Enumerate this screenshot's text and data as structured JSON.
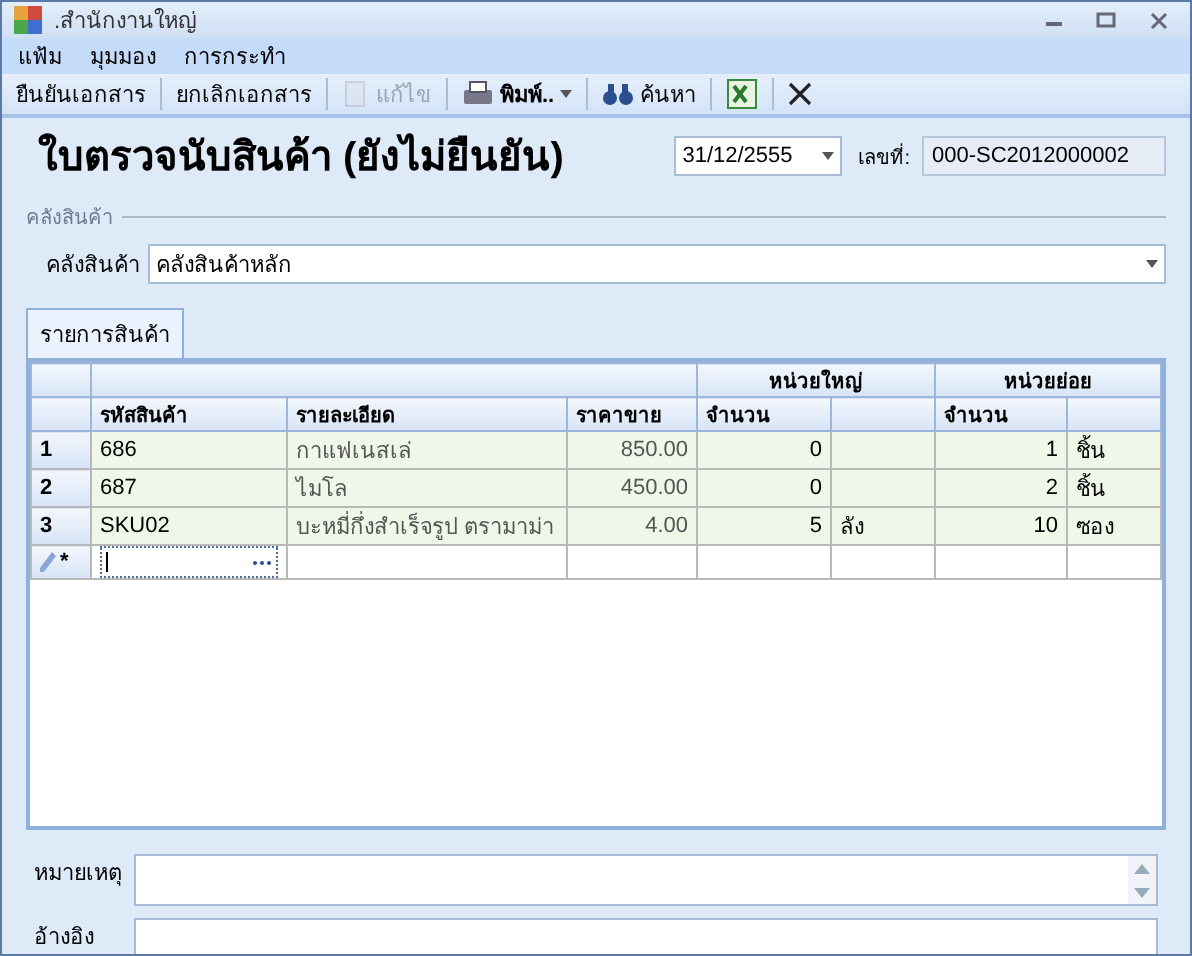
{
  "window": {
    "title": ".สำนักงานใหญ่"
  },
  "menu": [
    "แฟ้ม",
    "มุมมอง",
    "การกระทำ"
  ],
  "toolbar": [
    {
      "kind": "text",
      "label": "ยืนยันเอกสาร",
      "disabled": false
    },
    {
      "kind": "text",
      "label": "ยกเลิกเอกสาร",
      "disabled": false
    },
    {
      "kind": "edit",
      "label": "แก้ไข",
      "disabled": true
    },
    {
      "kind": "print",
      "label": "พิมพ์..",
      "disabled": false
    },
    {
      "kind": "find",
      "label": "ค้นหา",
      "disabled": false
    },
    {
      "kind": "excel",
      "disabled": false
    },
    {
      "kind": "close",
      "disabled": false
    }
  ],
  "heading": "ใบตรวจนับสินค้า (ยังไม่ยืนยัน)",
  "date": "31/12/2555",
  "doc_no": {
    "label": "เลขที่:",
    "value": "000-SC2012000002"
  },
  "group": {
    "title": "คลังสินค้า",
    "label": "คลังสินค้า",
    "value": "คลังสินค้าหลัก"
  },
  "tabs": [
    {
      "label": "รายการสินค้า",
      "selected": true
    }
  ],
  "grid": {
    "bands": [
      "หน่วยใหญ่",
      "หน่วยย่อย"
    ],
    "columns": [
      "รหัสสินค้า",
      "รายละเอียด",
      "ราคาขาย",
      "จำนวน",
      "จำนวน"
    ],
    "rows": [
      {
        "num": "1",
        "code": "686",
        "desc": "กาแฟเนสเล่",
        "price": "850.00",
        "big_qty": "0",
        "small_qty": "1",
        "small_unit": "ชิ้น"
      },
      {
        "num": "2",
        "code": "687",
        "desc": "ไมโล",
        "price": "450.00",
        "big_qty": "0",
        "small_qty": "2",
        "small_unit": "ชิ้น"
      },
      {
        "num": "3",
        "code": "SKU02",
        "desc": "บะหมี่กึ่งสำเร็จรูป ตรามาม่า",
        "price": "4.00",
        "big_qty": "5",
        "big_unit": "ลัง",
        "small_qty": "10",
        "small_unit": "ซอง"
      }
    ],
    "new_row_marker": "*"
  },
  "remarks": {
    "label": "หมายเหตุ"
  },
  "reference": {
    "label": "อ้างอิง"
  }
}
